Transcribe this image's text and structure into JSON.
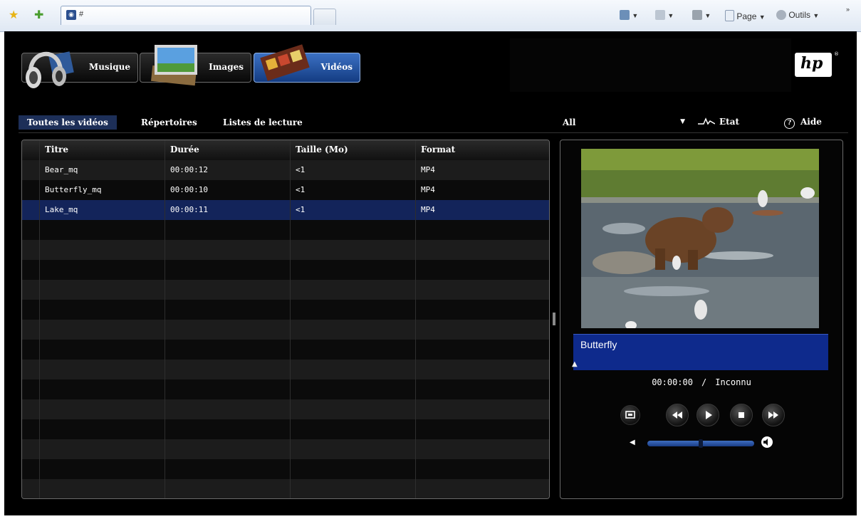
{
  "browser": {
    "tab_title": "#",
    "commands": {
      "page_label": "Page",
      "tools_label": "Outils"
    }
  },
  "app": {
    "media_tabs": [
      {
        "label": "Musique"
      },
      {
        "label": "Images"
      },
      {
        "label": "Vidéos"
      }
    ],
    "logo_text": "hp",
    "subtabs": [
      "Toutes les vidéos",
      "Répertoires",
      "Listes de lecture"
    ],
    "filter": {
      "value": "All"
    },
    "status_label": "Etat",
    "help_label": "Aide",
    "help_symbol": "?"
  },
  "table": {
    "columns": [
      "Titre",
      "Durée",
      "Taille (Mo)",
      "Format"
    ],
    "rows": [
      {
        "title": "Bear_mq",
        "duration": "00:00:12",
        "size": "<1",
        "format": "MP4"
      },
      {
        "title": "Butterfly_mq",
        "duration": "00:00:10",
        "size": "<1",
        "format": "MP4"
      },
      {
        "title": "Lake_mq",
        "duration": "00:00:11",
        "size": "<1",
        "format": "MP4"
      }
    ],
    "selected_row": 2
  },
  "player": {
    "now_playing": "Butterfly",
    "current_time": "00:00:00",
    "separator": "/",
    "total_time": "Inconnu",
    "volume_fraction": 0.5
  }
}
